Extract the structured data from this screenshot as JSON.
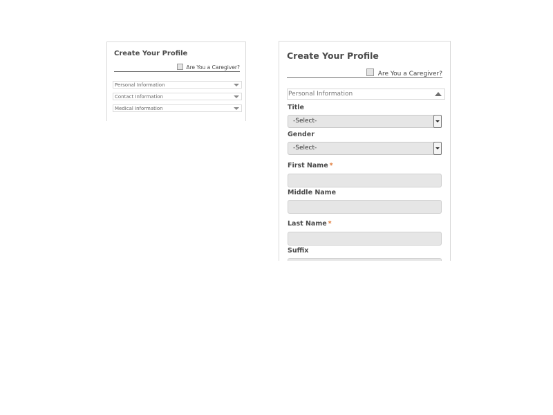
{
  "small_panel": {
    "title": "Create Your Profile",
    "caregiver_label": "Are You a Caregiver?",
    "sections": [
      {
        "label": "Personal Information"
      },
      {
        "label": "Contact Information"
      },
      {
        "label": "Medical Information"
      }
    ]
  },
  "large_panel": {
    "title": "Create Your Profile",
    "caregiver_label": "Are You a Caregiver?",
    "section_title": "Personal Information",
    "fields": {
      "title": {
        "label": "Title",
        "value": "-Select-"
      },
      "gender": {
        "label": "Gender",
        "value": "-Select-"
      },
      "first_name": {
        "label": "First Name",
        "required_mark": "*",
        "value": ""
      },
      "middle_name": {
        "label": "Middle Name",
        "value": ""
      },
      "last_name": {
        "label": "Last Name",
        "required_mark": "*",
        "value": ""
      },
      "suffix": {
        "label": "Suffix",
        "value": ""
      }
    }
  },
  "colors": {
    "required": "#e07b39",
    "field_bg": "#e6e6e6",
    "border": "#d8d8d8"
  }
}
